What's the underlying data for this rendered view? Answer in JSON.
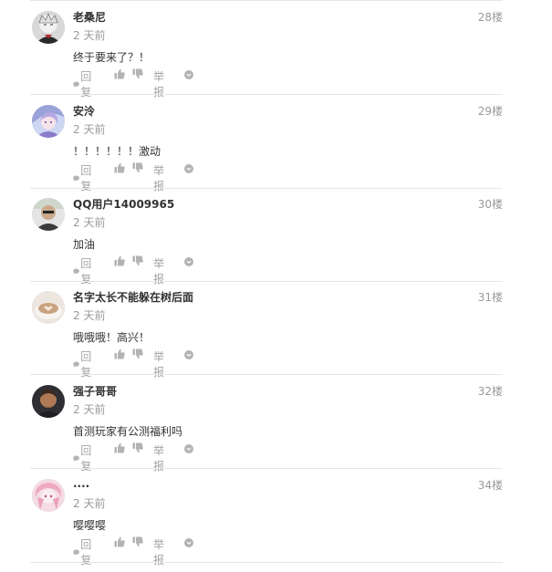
{
  "actions": {
    "reply_label": "回复",
    "report_label": "举报"
  },
  "comments": [
    {
      "username": "老桑尼",
      "time": "2 天前",
      "floor": "28楼",
      "content": "终于要来了？！"
    },
    {
      "username": "安泠",
      "time": "2 天前",
      "floor": "29楼",
      "content": "！！！！！！激动"
    },
    {
      "username": "QQ用户14009965",
      "time": "2 天前",
      "floor": "30楼",
      "content": "加油"
    },
    {
      "username": "名字太长不能躲在树后面",
      "time": "2 天前",
      "floor": "31楼",
      "content": "哦哦哦！高兴！"
    },
    {
      "username": "强子哥哥",
      "time": "2 天前",
      "floor": "32楼",
      "content": "首测玩家有公测福利吗"
    },
    {
      "username": "....",
      "time": "2 天前",
      "floor": "34楼",
      "content": "嘤嘤嘤"
    }
  ],
  "colors": {
    "text_primary": "#333333",
    "text_secondary": "#999999",
    "action_grey": "#a3a3a3",
    "divider": "#e6e6e6"
  },
  "icons": [
    "speech-bubble-icon",
    "thumbs-up-icon",
    "thumbs-down-icon",
    "more-circle-icon"
  ]
}
